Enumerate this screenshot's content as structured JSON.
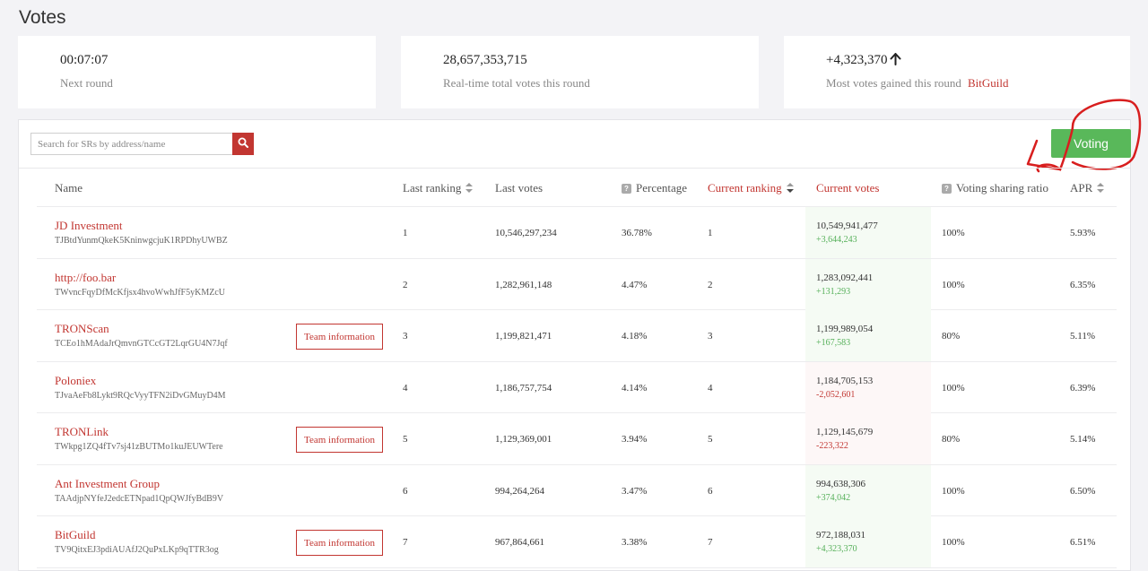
{
  "page": {
    "title": "Votes"
  },
  "stats": [
    {
      "value": "00:07:07",
      "label": "Next round"
    },
    {
      "value": "28,657,353,715",
      "label": "Real-time total votes this round"
    },
    {
      "value": "+4,323,370",
      "label": "Most votes gained this round",
      "highlight": "BitGuild"
    }
  ],
  "search": {
    "placeholder": "Search for SRs by address/name"
  },
  "voting_button": "Voting",
  "team_button_label": "Team information",
  "columns": {
    "name": "Name",
    "last_ranking": "Last ranking",
    "last_votes": "Last votes",
    "percentage": "Percentage",
    "current_ranking": "Current ranking",
    "current_votes": "Current votes",
    "voting_sharing_ratio": "Voting sharing ratio",
    "apr": "APR"
  },
  "rows": [
    {
      "name": "JD Investment",
      "address": "TJBtdYunmQkeK5KninwgcjuK1RPDhyUWBZ",
      "team": false,
      "last_ranking": "1",
      "last_votes": "10,546,297,234",
      "percentage": "36.78%",
      "current_ranking": "1",
      "current_votes": "10,549,941,477",
      "change": "+3,644,243",
      "change_dir": "pos",
      "sharing": "100%",
      "apr": "5.93%"
    },
    {
      "name": "http://foo.bar",
      "address": "TWvncFqyDfMcKfjsx4hvoWwhJfF5yKMZcU",
      "team": false,
      "last_ranking": "2",
      "last_votes": "1,282,961,148",
      "percentage": "4.47%",
      "current_ranking": "2",
      "current_votes": "1,283,092,441",
      "change": "+131,293",
      "change_dir": "pos",
      "sharing": "100%",
      "apr": "6.35%"
    },
    {
      "name": "TRONScan",
      "address": "TCEo1hMAdaJrQmvnGTCcGT2LqrGU4N7Jqf",
      "team": true,
      "last_ranking": "3",
      "last_votes": "1,199,821,471",
      "percentage": "4.18%",
      "current_ranking": "3",
      "current_votes": "1,199,989,054",
      "change": "+167,583",
      "change_dir": "pos",
      "sharing": "80%",
      "apr": "5.11%"
    },
    {
      "name": "Poloniex",
      "address": "TJvaAeFb8Lykt9RQcVyyTFN2iDvGMuyD4M",
      "team": false,
      "last_ranking": "4",
      "last_votes": "1,186,757,754",
      "percentage": "4.14%",
      "current_ranking": "4",
      "current_votes": "1,184,705,153",
      "change": "-2,052,601",
      "change_dir": "neg",
      "sharing": "100%",
      "apr": "6.39%"
    },
    {
      "name": "TRONLink",
      "address": "TWkpg1ZQ4fTv7sj41zBUTMo1kuJEUWTere",
      "team": true,
      "last_ranking": "5",
      "last_votes": "1,129,369,001",
      "percentage": "3.94%",
      "current_ranking": "5",
      "current_votes": "1,129,145,679",
      "change": "-223,322",
      "change_dir": "neg",
      "sharing": "80%",
      "apr": "5.14%"
    },
    {
      "name": "Ant Investment Group",
      "address": "TAAdjpNYfeJ2edcETNpad1QpQWJfyBdB9V",
      "team": false,
      "last_ranking": "6",
      "last_votes": "994,264,264",
      "percentage": "3.47%",
      "current_ranking": "6",
      "current_votes": "994,638,306",
      "change": "+374,042",
      "change_dir": "pos",
      "sharing": "100%",
      "apr": "6.50%"
    },
    {
      "name": "BitGuild",
      "address": "TV9QitxEJ3pdiAUAfJ2QuPxLKp9qTTR3og",
      "team": true,
      "last_ranking": "7",
      "last_votes": "967,864,661",
      "percentage": "3.38%",
      "current_ranking": "7",
      "current_votes": "972,188,031",
      "change": "+4,323,370",
      "change_dir": "pos",
      "sharing": "100%",
      "apr": "6.51%"
    }
  ]
}
